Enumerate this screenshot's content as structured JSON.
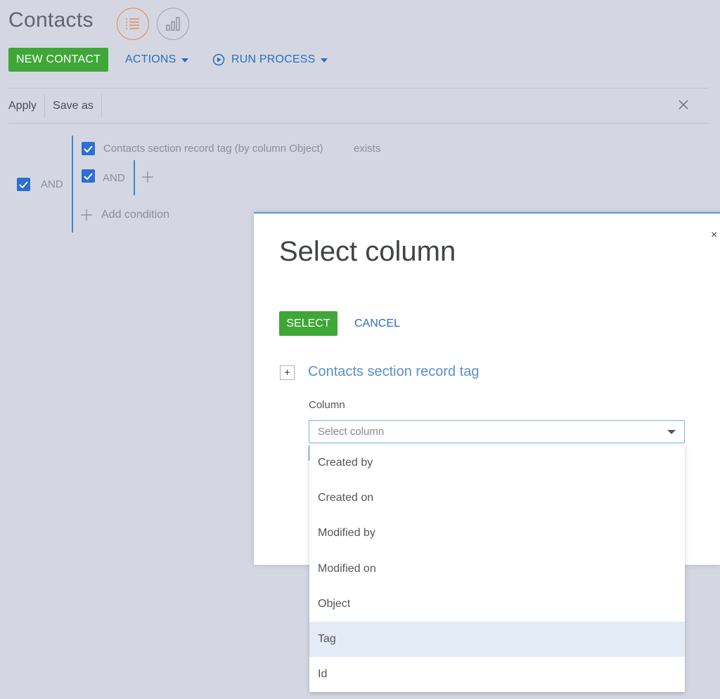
{
  "header": {
    "title": "Contacts",
    "view_list_icon": "list-icon",
    "view_chart_icon": "bar-chart-icon"
  },
  "toolbar": {
    "new_contact": "NEW CONTACT",
    "actions": "ACTIONS",
    "run_process": "RUN PROCESS"
  },
  "filter_bar": {
    "apply": "Apply",
    "save_as": "Save as"
  },
  "filter": {
    "root_operator": "AND",
    "condition_text": "Contacts section record tag (by column Object)",
    "condition_value": "exists",
    "nested_operator": "AND",
    "add_condition": "Add condition"
  },
  "dialog": {
    "title": "Select column",
    "select_label": "SELECT",
    "cancel_label": "CANCEL",
    "close_glyph": "×",
    "tree_node_label": "Contacts section record tag",
    "tree_expand_glyph": "+",
    "column_label": "Column",
    "column_placeholder": "Select column"
  },
  "dropdown": {
    "items": [
      "Created by",
      "Created on",
      "Modified by",
      "Modified on",
      "Object",
      "Tag",
      "Id"
    ],
    "highlighted": "Tag"
  },
  "colors": {
    "accent_green": "#3fa737",
    "link_blue": "#2b6cbf",
    "checkbox_blue": "#2c6fd0",
    "background": "#d4d7e1"
  }
}
